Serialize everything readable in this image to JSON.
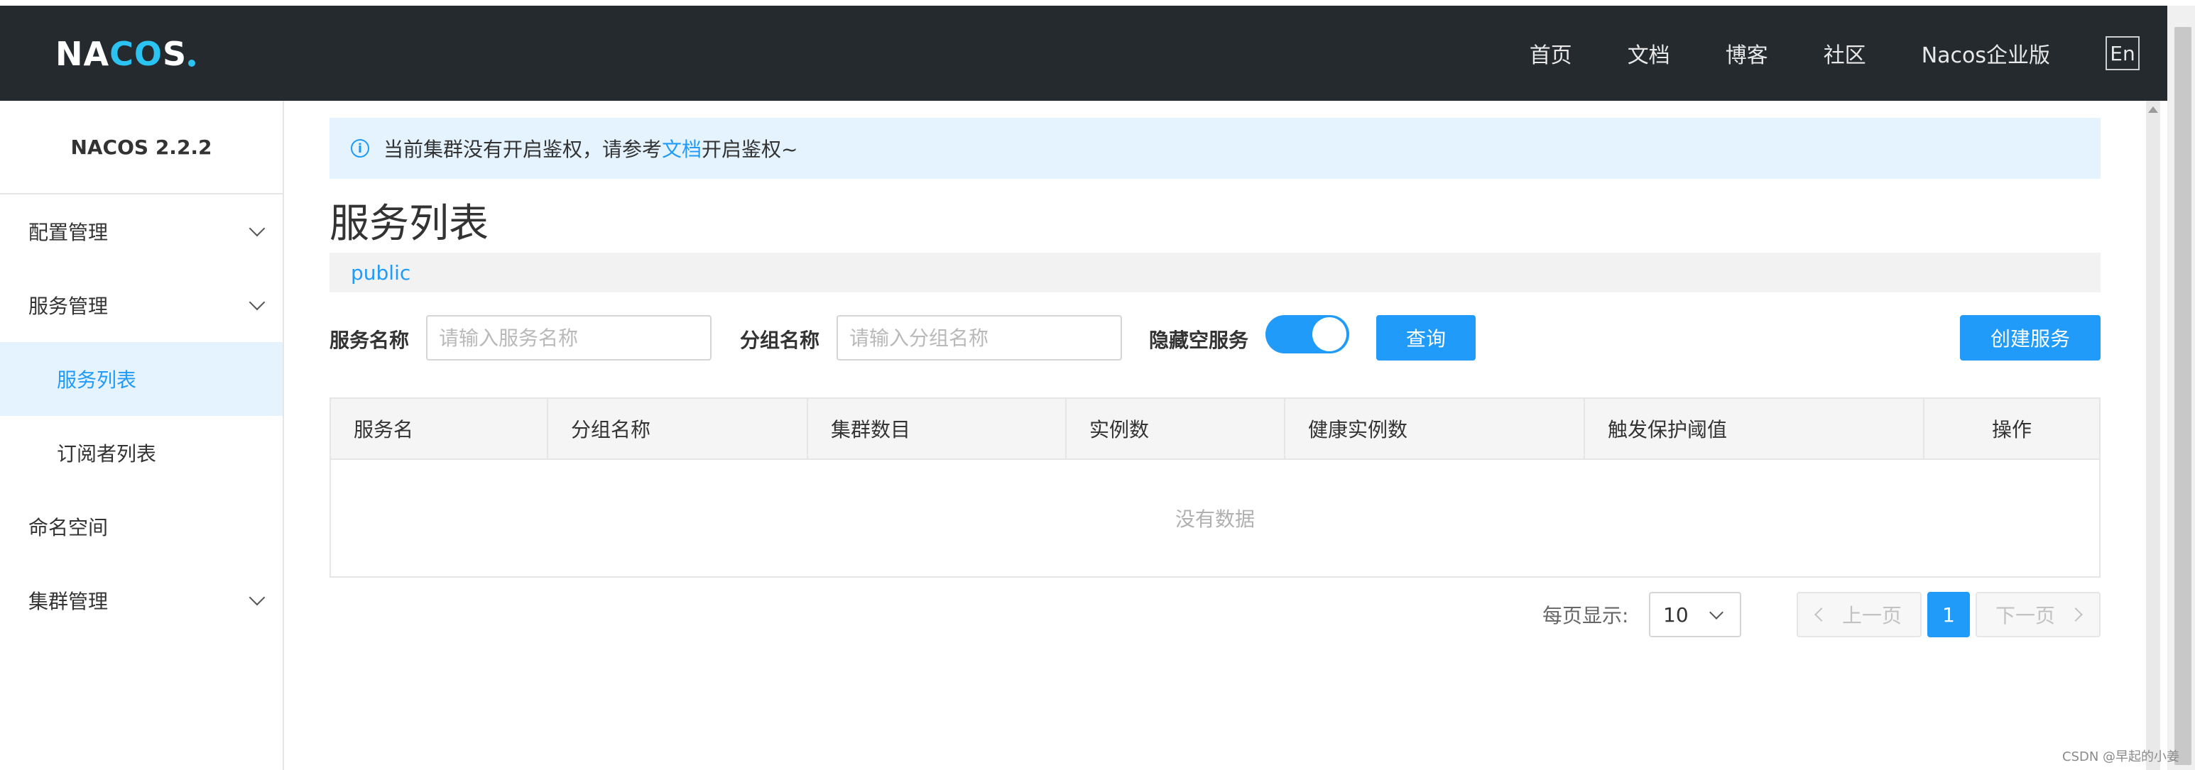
{
  "header": {
    "logo_text_a": "NA",
    "logo_text_b": "CO",
    "logo_text_c": "S",
    "nav": [
      "首页",
      "文档",
      "博客",
      "社区",
      "Nacos企业版"
    ],
    "lang": "En"
  },
  "sidebar": {
    "version": "NACOS 2.2.2",
    "items": [
      {
        "label": "配置管理"
      },
      {
        "label": "服务管理"
      },
      {
        "label": "服务列表"
      },
      {
        "label": "订阅者列表"
      },
      {
        "label": "命名空间"
      },
      {
        "label": "集群管理"
      }
    ]
  },
  "notice": {
    "prefix": "当前集群没有开启鉴权，请参考",
    "link": "文档",
    "suffix": "开启鉴权~",
    "icon": "info-icon"
  },
  "page": {
    "title": "服务列表",
    "namespace": "public"
  },
  "filters": {
    "service_name_label": "服务名称",
    "service_name_placeholder": "请输入服务名称",
    "group_name_label": "分组名称",
    "group_name_placeholder": "请输入分组名称",
    "hide_empty_label": "隐藏空服务",
    "query_button": "查询",
    "create_button": "创建服务"
  },
  "table": {
    "columns": [
      "服务名",
      "分组名称",
      "集群数目",
      "实例数",
      "健康实例数",
      "触发保护阈值",
      "操作"
    ],
    "empty_text": "没有数据"
  },
  "pagination": {
    "per_page_label": "每页显示:",
    "page_size": "10",
    "prev": "上一页",
    "current": "1",
    "next": "下一页"
  },
  "watermark": "CSDN @早起的小姜",
  "colors": {
    "accent": "#209bfa",
    "header_bg": "#252a2f",
    "logo_accent": "#2bc3f2"
  }
}
